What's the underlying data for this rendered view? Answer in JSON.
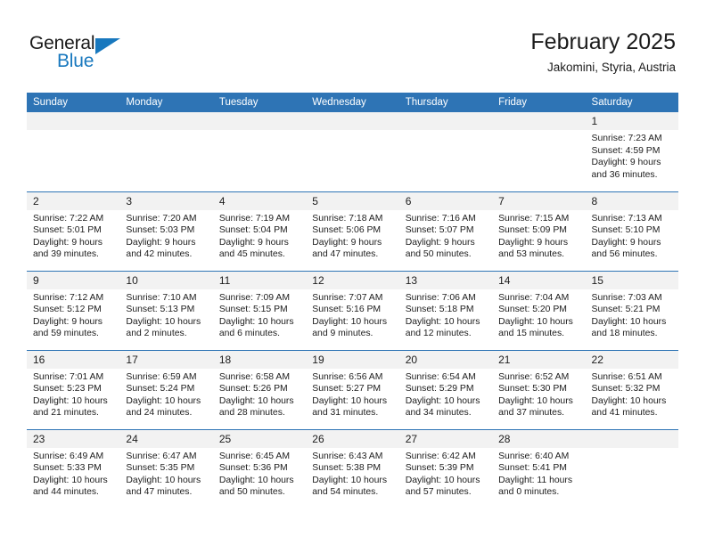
{
  "brand": {
    "name_top": "General",
    "name_bottom": "Blue",
    "accent_color": "#1878be",
    "triangle_icon": "blue-triangle-icon"
  },
  "header": {
    "title": "February 2025",
    "subtitle": "Jakomini, Styria, Austria",
    "header_bg_color": "#2e74b5",
    "day_band_color": "#f2f2f2"
  },
  "weekday_headers": [
    "Sunday",
    "Monday",
    "Tuesday",
    "Wednesday",
    "Thursday",
    "Friday",
    "Saturday"
  ],
  "labels": {
    "sunrise_prefix": "Sunrise:",
    "sunset_prefix": "Sunset:",
    "daylight_prefix": "Daylight:"
  },
  "weeks": [
    [
      {
        "day": "",
        "blank": true
      },
      {
        "day": "",
        "blank": true
      },
      {
        "day": "",
        "blank": true
      },
      {
        "day": "",
        "blank": true
      },
      {
        "day": "",
        "blank": true
      },
      {
        "day": "",
        "blank": true
      },
      {
        "day": "1",
        "sunrise": "Sunrise: 7:23 AM",
        "sunset": "Sunset: 4:59 PM",
        "daylight_line1": "Daylight: 9 hours",
        "daylight_line2": "and 36 minutes."
      }
    ],
    [
      {
        "day": "2",
        "sunrise": "Sunrise: 7:22 AM",
        "sunset": "Sunset: 5:01 PM",
        "daylight_line1": "Daylight: 9 hours",
        "daylight_line2": "and 39 minutes."
      },
      {
        "day": "3",
        "sunrise": "Sunrise: 7:20 AM",
        "sunset": "Sunset: 5:03 PM",
        "daylight_line1": "Daylight: 9 hours",
        "daylight_line2": "and 42 minutes."
      },
      {
        "day": "4",
        "sunrise": "Sunrise: 7:19 AM",
        "sunset": "Sunset: 5:04 PM",
        "daylight_line1": "Daylight: 9 hours",
        "daylight_line2": "and 45 minutes."
      },
      {
        "day": "5",
        "sunrise": "Sunrise: 7:18 AM",
        "sunset": "Sunset: 5:06 PM",
        "daylight_line1": "Daylight: 9 hours",
        "daylight_line2": "and 47 minutes."
      },
      {
        "day": "6",
        "sunrise": "Sunrise: 7:16 AM",
        "sunset": "Sunset: 5:07 PM",
        "daylight_line1": "Daylight: 9 hours",
        "daylight_line2": "and 50 minutes."
      },
      {
        "day": "7",
        "sunrise": "Sunrise: 7:15 AM",
        "sunset": "Sunset: 5:09 PM",
        "daylight_line1": "Daylight: 9 hours",
        "daylight_line2": "and 53 minutes."
      },
      {
        "day": "8",
        "sunrise": "Sunrise: 7:13 AM",
        "sunset": "Sunset: 5:10 PM",
        "daylight_line1": "Daylight: 9 hours",
        "daylight_line2": "and 56 minutes."
      }
    ],
    [
      {
        "day": "9",
        "sunrise": "Sunrise: 7:12 AM",
        "sunset": "Sunset: 5:12 PM",
        "daylight_line1": "Daylight: 9 hours",
        "daylight_line2": "and 59 minutes."
      },
      {
        "day": "10",
        "sunrise": "Sunrise: 7:10 AM",
        "sunset": "Sunset: 5:13 PM",
        "daylight_line1": "Daylight: 10 hours",
        "daylight_line2": "and 2 minutes."
      },
      {
        "day": "11",
        "sunrise": "Sunrise: 7:09 AM",
        "sunset": "Sunset: 5:15 PM",
        "daylight_line1": "Daylight: 10 hours",
        "daylight_line2": "and 6 minutes."
      },
      {
        "day": "12",
        "sunrise": "Sunrise: 7:07 AM",
        "sunset": "Sunset: 5:16 PM",
        "daylight_line1": "Daylight: 10 hours",
        "daylight_line2": "and 9 minutes."
      },
      {
        "day": "13",
        "sunrise": "Sunrise: 7:06 AM",
        "sunset": "Sunset: 5:18 PM",
        "daylight_line1": "Daylight: 10 hours",
        "daylight_line2": "and 12 minutes."
      },
      {
        "day": "14",
        "sunrise": "Sunrise: 7:04 AM",
        "sunset": "Sunset: 5:20 PM",
        "daylight_line1": "Daylight: 10 hours",
        "daylight_line2": "and 15 minutes."
      },
      {
        "day": "15",
        "sunrise": "Sunrise: 7:03 AM",
        "sunset": "Sunset: 5:21 PM",
        "daylight_line1": "Daylight: 10 hours",
        "daylight_line2": "and 18 minutes."
      }
    ],
    [
      {
        "day": "16",
        "sunrise": "Sunrise: 7:01 AM",
        "sunset": "Sunset: 5:23 PM",
        "daylight_line1": "Daylight: 10 hours",
        "daylight_line2": "and 21 minutes."
      },
      {
        "day": "17",
        "sunrise": "Sunrise: 6:59 AM",
        "sunset": "Sunset: 5:24 PM",
        "daylight_line1": "Daylight: 10 hours",
        "daylight_line2": "and 24 minutes."
      },
      {
        "day": "18",
        "sunrise": "Sunrise: 6:58 AM",
        "sunset": "Sunset: 5:26 PM",
        "daylight_line1": "Daylight: 10 hours",
        "daylight_line2": "and 28 minutes."
      },
      {
        "day": "19",
        "sunrise": "Sunrise: 6:56 AM",
        "sunset": "Sunset: 5:27 PM",
        "daylight_line1": "Daylight: 10 hours",
        "daylight_line2": "and 31 minutes."
      },
      {
        "day": "20",
        "sunrise": "Sunrise: 6:54 AM",
        "sunset": "Sunset: 5:29 PM",
        "daylight_line1": "Daylight: 10 hours",
        "daylight_line2": "and 34 minutes."
      },
      {
        "day": "21",
        "sunrise": "Sunrise: 6:52 AM",
        "sunset": "Sunset: 5:30 PM",
        "daylight_line1": "Daylight: 10 hours",
        "daylight_line2": "and 37 minutes."
      },
      {
        "day": "22",
        "sunrise": "Sunrise: 6:51 AM",
        "sunset": "Sunset: 5:32 PM",
        "daylight_line1": "Daylight: 10 hours",
        "daylight_line2": "and 41 minutes."
      }
    ],
    [
      {
        "day": "23",
        "sunrise": "Sunrise: 6:49 AM",
        "sunset": "Sunset: 5:33 PM",
        "daylight_line1": "Daylight: 10 hours",
        "daylight_line2": "and 44 minutes."
      },
      {
        "day": "24",
        "sunrise": "Sunrise: 6:47 AM",
        "sunset": "Sunset: 5:35 PM",
        "daylight_line1": "Daylight: 10 hours",
        "daylight_line2": "and 47 minutes."
      },
      {
        "day": "25",
        "sunrise": "Sunrise: 6:45 AM",
        "sunset": "Sunset: 5:36 PM",
        "daylight_line1": "Daylight: 10 hours",
        "daylight_line2": "and 50 minutes."
      },
      {
        "day": "26",
        "sunrise": "Sunrise: 6:43 AM",
        "sunset": "Sunset: 5:38 PM",
        "daylight_line1": "Daylight: 10 hours",
        "daylight_line2": "and 54 minutes."
      },
      {
        "day": "27",
        "sunrise": "Sunrise: 6:42 AM",
        "sunset": "Sunset: 5:39 PM",
        "daylight_line1": "Daylight: 10 hours",
        "daylight_line2": "and 57 minutes."
      },
      {
        "day": "28",
        "sunrise": "Sunrise: 6:40 AM",
        "sunset": "Sunset: 5:41 PM",
        "daylight_line1": "Daylight: 11 hours",
        "daylight_line2": "and 0 minutes."
      },
      {
        "day": "",
        "blank": true
      }
    ]
  ]
}
